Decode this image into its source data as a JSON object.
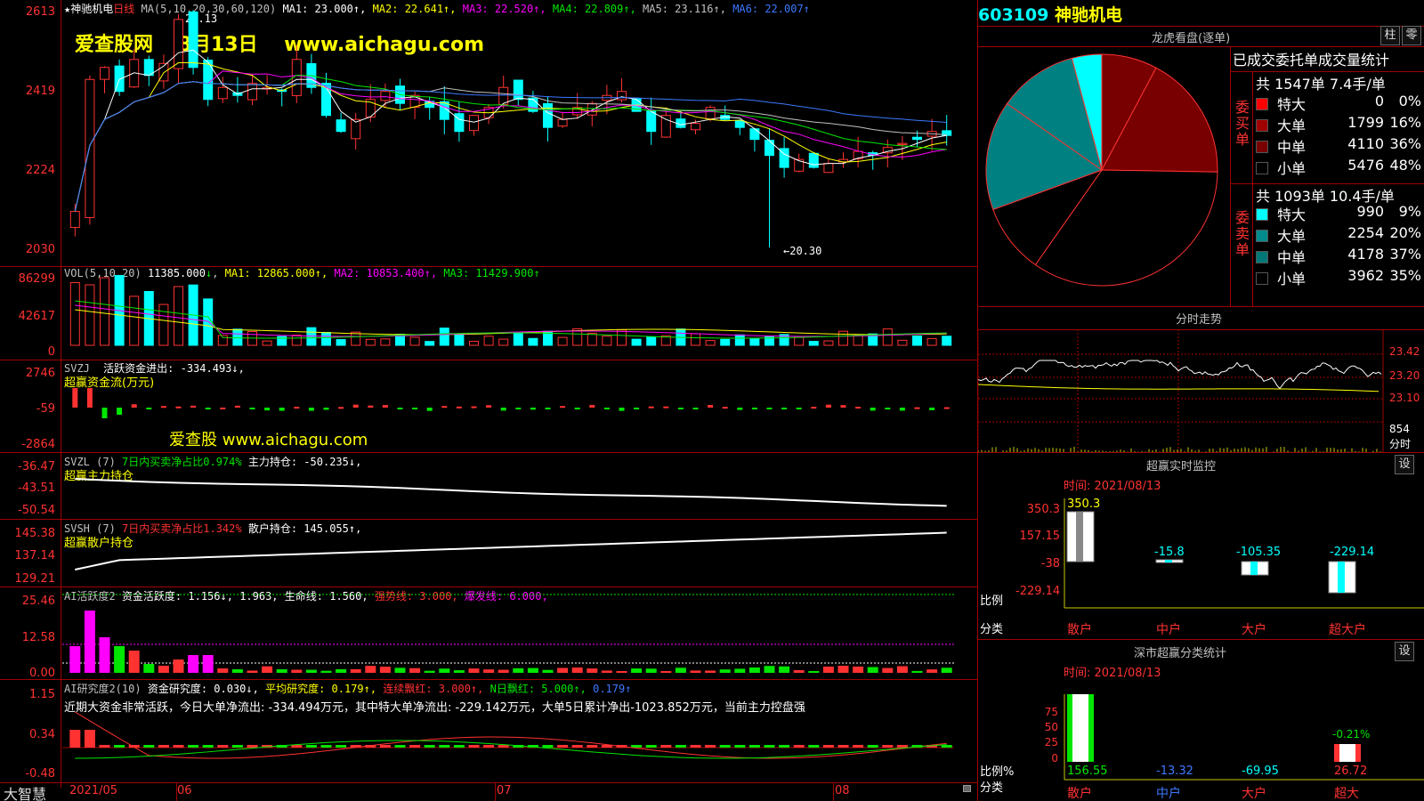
{
  "stock": {
    "code": "603109",
    "name": "神驰机电"
  },
  "watermark": {
    "site_name": "爱查股网",
    "date": "8月13日",
    "url": "www.aichagu.com",
    "url2": "爱查股 www.aichagu.com"
  },
  "kline": {
    "title": "★神驰机电",
    "period": "日线",
    "ma_params": "MA(5,10,20,30,60,120)",
    "ma": [
      {
        "label": "MA1:",
        "value": "23.000",
        "arrow": "↑",
        "color": "#ffffff"
      },
      {
        "label": "MA2:",
        "value": "22.641",
        "arrow": "↑",
        "color": "#ffff00"
      },
      {
        "label": "MA3:",
        "value": "22.520",
        "arrow": "↑",
        "color": "#ff00ff"
      },
      {
        "label": "MA4:",
        "value": "22.809",
        "arrow": "↑",
        "color": "#00e600"
      },
      {
        "label": "MA5:",
        "value": "23.116",
        "arrow": "↑",
        "color": "#c0c0c0"
      },
      {
        "label": "MA6:",
        "value": "22.007",
        "arrow": "↑",
        "color": "#3c78ff"
      }
    ],
    "high_label": "26.13",
    "low_label": "←20.30",
    "y_ticks": [
      "2613",
      "2419",
      "2224",
      "2030"
    ]
  },
  "vol": {
    "title": "VOL(5,10,20)",
    "value": "11385.000",
    "arrow": "↓",
    "ma1": "MA1: 12865.000↑,",
    "ma2": "MA2: 10853.400↑,",
    "ma3": "MA3: 11429.900↑",
    "y_ticks": [
      "86299",
      "42617",
      "0"
    ]
  },
  "svzj": {
    "title": "SVZJ",
    "text": "活跃资金进出: -334.493↓,",
    "sub": "超赢资金流(万元)",
    "y_ticks": [
      "2746",
      "-59",
      "-2864"
    ]
  },
  "svzl": {
    "title": "SVZL (7)",
    "text1": "7日内买卖净占比0.974%",
    "text2": "主力持仓: -50.235↓,",
    "sub": "超赢主力持仓",
    "y_ticks": [
      "-36.47",
      "-43.51",
      "-50.54"
    ]
  },
  "svsh": {
    "title": "SVSH (7)",
    "text1": "7日内买卖净占比1.342%",
    "text2": "散户持仓: 145.055↑,",
    "sub": "超赢散户持仓",
    "y_ticks": [
      "145.38",
      "137.14",
      "129.21"
    ]
  },
  "ai_active": {
    "title": "AI活跃度2",
    "t1": "资金活跃度: 1.156↓,",
    "t2": "1.963,",
    "t3": "生命线: 1.560,",
    "t4": "强势线: 3.000,",
    "t5": "爆发线: 6.000,",
    "y_ticks": [
      "25.46",
      "12.58",
      "0.00"
    ]
  },
  "ai_research": {
    "title": "AI研究度2(10)",
    "t1": "资金研究度: 0.030↓,",
    "t2": "平均研究度: 0.179↑,",
    "t3": "连续飘红: 3.000↑,",
    "t4": "N日飘红: 5.000↑,",
    "t5": "0.179↑",
    "desc": "近期大资金非常活跃，今日大单净流出: -334.494万元，其中特大单净流出: -229.142万元，大单5日累计净出-1023.852万元，当前主力控盘强",
    "y_ticks": [
      "1.15",
      "0.34",
      "-0.48"
    ]
  },
  "xaxis": {
    "logo": "大智慧",
    "labels": [
      "2021/05",
      "06",
      "07",
      "08"
    ]
  },
  "longhu": {
    "title": "龙虎看盘(逐单)",
    "btn1": "柱",
    "btn2": "零",
    "header": "已成交委托单成交量统计",
    "buy": {
      "side": "委买单",
      "total": "共 1547单 7.4手/单",
      "rows": [
        {
          "name": "特大",
          "vol": "0",
          "pct": "0%",
          "color": "#ff0000"
        },
        {
          "name": "大单",
          "vol": "1799",
          "pct": "16%",
          "color": "#a00000"
        },
        {
          "name": "中单",
          "vol": "4110",
          "pct": "36%",
          "color": "#780000"
        },
        {
          "name": "小单",
          "vol": "5476",
          "pct": "48%",
          "color": "#000000"
        }
      ]
    },
    "sell": {
      "side": "委卖单",
      "total": "共 1093单 10.4手/单",
      "rows": [
        {
          "name": "特大",
          "vol": "990",
          "pct": "9%",
          "color": "#00ffff"
        },
        {
          "name": "大单",
          "vol": "2254",
          "pct": "20%",
          "color": "#008c8c"
        },
        {
          "name": "中单",
          "vol": "4178",
          "pct": "37%",
          "color": "#007878"
        },
        {
          "name": "小单",
          "vol": "3962",
          "pct": "35%",
          "color": "#000000"
        }
      ]
    }
  },
  "fenshi": {
    "title": "分时走势",
    "y_ticks": [
      "23.42",
      "23.20",
      "23.10"
    ],
    "vol_tick": "854",
    "unit": "分时"
  },
  "monitor": {
    "title": "超赢实时监控",
    "btn": "设",
    "date": "时间: 2021/08/13",
    "y_ticks": [
      "350.3",
      "157.15",
      "-38",
      "-229.14"
    ],
    "ratio": "比例",
    "cat": "分类",
    "bars": [
      {
        "label": "散户",
        "value": "350.3"
      },
      {
        "label": "中户",
        "value": "-15.8"
      },
      {
        "label": "大户",
        "value": "-105.35"
      },
      {
        "label": "超大户",
        "value": "-229.14"
      }
    ]
  },
  "szstat": {
    "title": "深市超赢分类统计",
    "btn": "设",
    "date": "时间: 2021/08/13",
    "y_ticks": [
      "75",
      "50",
      "25",
      "0"
    ],
    "ratio": "比例%",
    "cat": "分类",
    "pct_label": "-0.21%",
    "bars": [
      {
        "label": "散户",
        "value": "156.55"
      },
      {
        "label": "中户",
        "value": "-13.32"
      },
      {
        "label": "大户",
        "value": "-69.95"
      },
      {
        "label": "超大",
        "value": "26.72"
      }
    ]
  }
}
